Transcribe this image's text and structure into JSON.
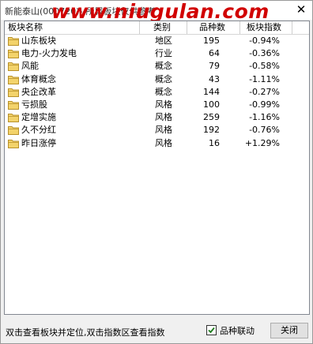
{
  "window": {
    "title": "新能泰山(000720)--所属板块仅供参考",
    "watermark": "www.niugulan.com",
    "close_glyph": "✕"
  },
  "table": {
    "columns": [
      "板块名称",
      "类别",
      "品种数",
      "板块指数"
    ],
    "rows": [
      {
        "name": "山东板块",
        "type": "地区",
        "count": "195",
        "index": "-0.94%"
      },
      {
        "name": "电力-火力发电",
        "type": "行业",
        "count": "64",
        "index": "-0.36%"
      },
      {
        "name": "风能",
        "type": "概念",
        "count": "79",
        "index": "-0.58%"
      },
      {
        "name": "体育概念",
        "type": "概念",
        "count": "43",
        "index": "-1.11%"
      },
      {
        "name": "央企改革",
        "type": "概念",
        "count": "144",
        "index": "-0.27%"
      },
      {
        "name": "亏损股",
        "type": "风格",
        "count": "100",
        "index": "-0.99%"
      },
      {
        "name": "定增实施",
        "type": "风格",
        "count": "259",
        "index": "-1.16%"
      },
      {
        "name": "久不分红",
        "type": "风格",
        "count": "192",
        "index": "-0.76%"
      },
      {
        "name": "昨日涨停",
        "type": "风格",
        "count": "16",
        "index": "+1.29%"
      }
    ]
  },
  "footer": {
    "hint": "双击查看板块并定位,双击指数区查看指数",
    "checkbox_label": "品种联动",
    "checkbox_checked": true,
    "close_button": "关闭"
  },
  "colors": {
    "folder_fill": "#f3d36b",
    "folder_stroke": "#b8912a",
    "watermark": "#d10000",
    "checkmark": "#1a7a1a"
  },
  "icons": {
    "row_icon": "folder-icon",
    "close_icon": "close-icon",
    "check_icon": "checkmark-icon"
  }
}
